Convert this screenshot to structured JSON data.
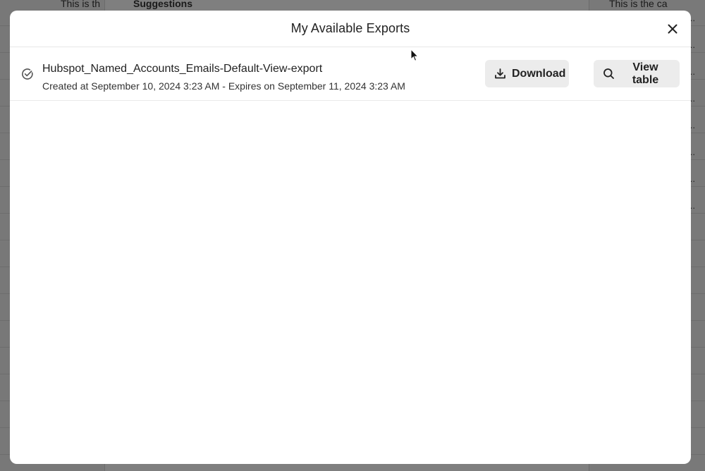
{
  "background": {
    "left_row_texts": [
      "This is th"
    ],
    "mid_header": "Suggestions",
    "right_row_texts": [
      "This is the ca"
    ],
    "row_ellipsis": "..."
  },
  "modal": {
    "title": "My Available Exports",
    "close_icon": "close-icon",
    "exports": [
      {
        "status_icon": "check-circle-icon",
        "name": "Hubspot_Named_Accounts_Emails-Default-View-export",
        "meta": "Created at September 10, 2024 3:23 AM - Expires on September 11, 2024 3:23 AM",
        "download_label": "Download",
        "download_icon": "download-icon",
        "view_label": "View table",
        "view_icon": "search-icon"
      }
    ]
  },
  "colors": {
    "overlay": "#000000",
    "modal_bg": "#ffffff",
    "button_bg": "#ececec",
    "text": "#222222"
  }
}
